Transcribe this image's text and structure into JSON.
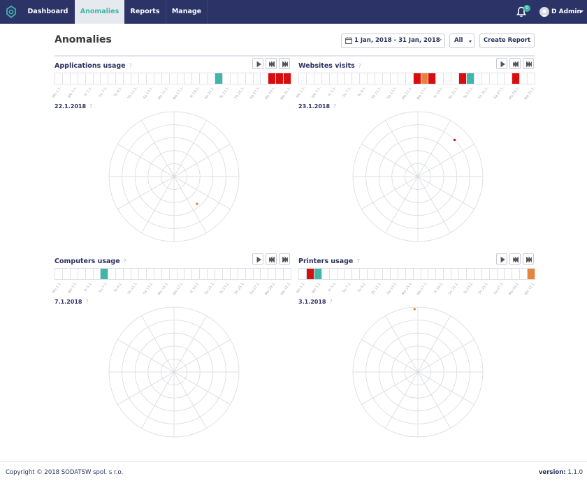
{
  "nav": {
    "tabs": [
      {
        "label": "Dashboard",
        "active": false
      },
      {
        "label": "Anomalies",
        "active": true
      },
      {
        "label": "Reports",
        "active": false
      },
      {
        "label": "Manage",
        "active": false
      }
    ],
    "notifications_count": "0",
    "user_name": "D Admin"
  },
  "page": {
    "title": "Anomalies",
    "date_range": "1 Jan, 2018 - 31 Jan, 2018",
    "filter_value": "All",
    "create_report_label": "Create Report"
  },
  "colors": {
    "navy": "#2b3367",
    "teal": "#3fb6a8",
    "red": "#d90d0d",
    "orange": "#e5843a"
  },
  "tick_labels": [
    "Mo 1.1.",
    "We 3.1.",
    "Fr 5.1.",
    "Su 7.1.",
    "Tu 9.1.",
    "Th 11.1.",
    "Sa 13.1.",
    "Mo 15.1.",
    "We 17.1.",
    "Fr 19.1.",
    "Su 21.1.",
    "Tu 23.1.",
    "Th 25.1.",
    "Sa 27.1.",
    "Mo 29.1.",
    "We 31.1."
  ],
  "panels": [
    {
      "title": "Applications usage",
      "help": "?",
      "selected_date": "22.1.2018",
      "day_states": {
        "22": "selected",
        "29": "red",
        "30": "red",
        "31": "red"
      },
      "points": [
        {
          "angle_deg": 140,
          "radius_fraction": 0.55,
          "color": "orange"
        }
      ]
    },
    {
      "title": "Websites visits",
      "help": "?",
      "selected_date": "23.1.2018",
      "day_states": {
        "16": "red",
        "17": "orange",
        "18": "red",
        "22": "red",
        "23": "selected",
        "29": "red"
      },
      "points": [
        {
          "angle_deg": 45,
          "radius_fraction": 0.8,
          "color": "red"
        }
      ]
    },
    {
      "title": "Computers usage",
      "help": "?",
      "selected_date": "7.1.2018",
      "day_states": {
        "7": "selected"
      },
      "points": []
    },
    {
      "title": "Printers usage",
      "help": "?",
      "selected_date": "3.1.2018",
      "day_states": {
        "2": "red",
        "3": "selected",
        "31": "orange"
      },
      "points": [
        {
          "angle_deg": 357,
          "radius_fraction": 0.97,
          "color": "orange"
        }
      ]
    }
  ],
  "footer": {
    "copyright": "Copyright © 2018 SODATSW spol. s r.o.",
    "version_label": "version:",
    "version_value": "1.1.0"
  }
}
